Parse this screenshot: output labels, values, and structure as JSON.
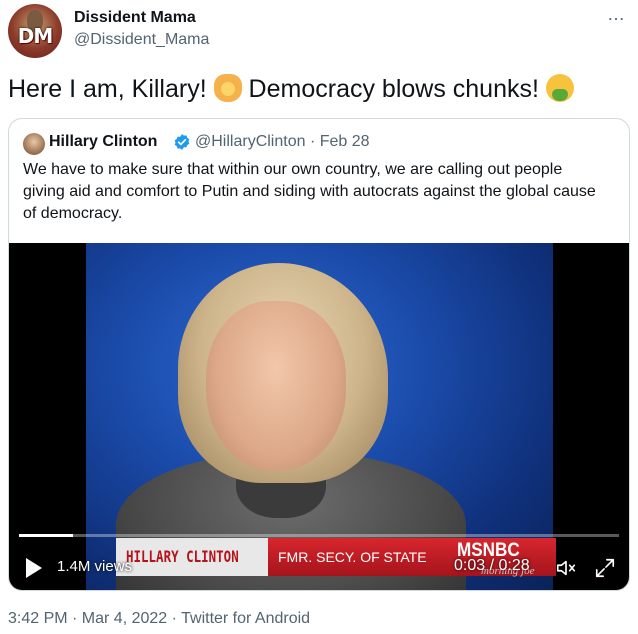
{
  "tweet": {
    "author_name": "Dissident Mama",
    "author_handle": "@Dissident_Mama",
    "avatar_text": "DM",
    "more_label": "…",
    "text_part1": "Here I am, Killary! ",
    "emoji1": "person-raising-hand-emoji",
    "text_part2": " Democracy blows chunks! ",
    "emoji2": "face-vomiting-emoji",
    "footer": "3:42 PM · Mar 4, 2022 · Twitter for Android"
  },
  "quote": {
    "author_name": "Hillary Clinton",
    "verified_icon": "verified-badge-icon",
    "handle_date": "@HillaryClinton · Feb 28",
    "text": "We have to make sure that within our own country, we are calling out people giving aid and comfort to Putin and siding with autocrats against the global cause of democracy."
  },
  "video": {
    "lower_third_name": "HILLARY CLINTON",
    "lower_third_title": "FMR. SECY. OF STATE",
    "network": "MSNBC",
    "show": "morning joe",
    "views": "1.4M views",
    "time": "0:03 / 0:28",
    "progress": 0.09,
    "colors": {
      "accent_red": "#c8202a",
      "bg_blue": "#1a4aa8"
    },
    "icons": [
      "play-icon",
      "mute-icon",
      "fullscreen-icon"
    ]
  }
}
